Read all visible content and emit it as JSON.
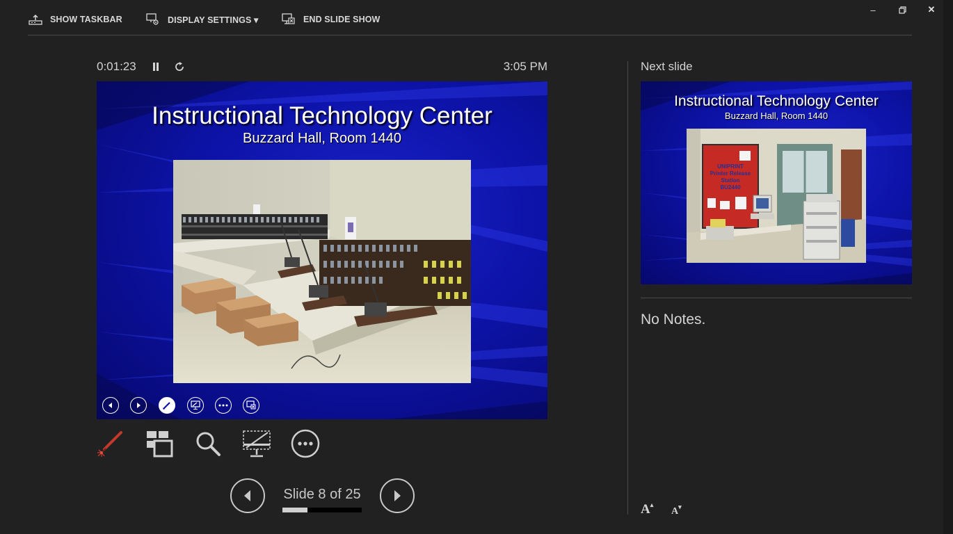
{
  "toolbar": {
    "show_taskbar": "SHOW TASKBAR",
    "display_settings": "DISPLAY SETTINGS ▾",
    "end_slide_show": "END SLIDE SHOW"
  },
  "window": {
    "minimize": "–",
    "restore": "🗗",
    "close": "✕"
  },
  "presenter": {
    "elapsed": "0:01:23",
    "clock": "3:05 PM",
    "slide_counter": "Slide 8 of 25",
    "progress_fraction": 0.32
  },
  "current_slide": {
    "title": "Instructional Technology Center",
    "subtitle": "Buzzard Hall, Room 1440"
  },
  "next_panel": {
    "label": "Next slide",
    "title": "Instructional Technology Center",
    "subtitle": "Buzzard Hall, Room 1440",
    "board_lines": [
      "UNIPRINT",
      "Printer Release",
      "Station",
      "BU2440"
    ]
  },
  "notes": {
    "text": "No Notes."
  },
  "colors": {
    "background": "#212121",
    "laser": "#c0392b",
    "slide_blue": "#0d13a8"
  }
}
